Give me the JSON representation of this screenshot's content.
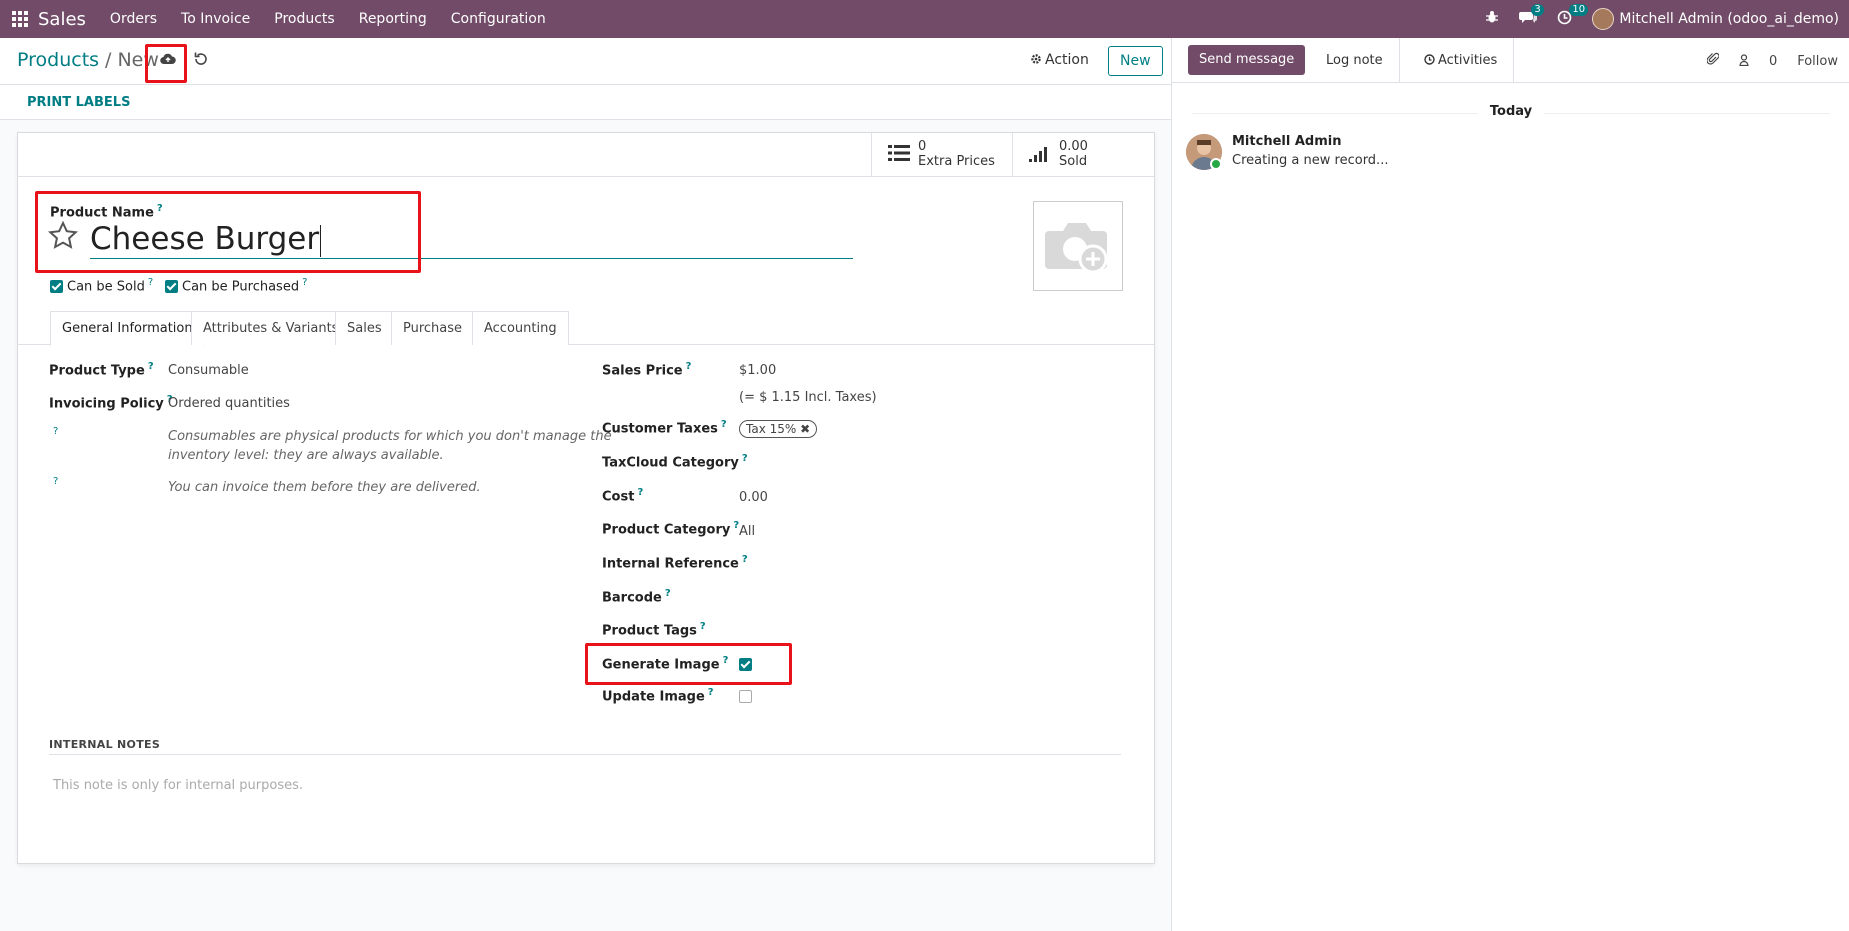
{
  "navbar": {
    "brand": "Sales",
    "menu": [
      "Orders",
      "To Invoice",
      "Products",
      "Reporting",
      "Configuration"
    ],
    "messages_count": "3",
    "activities_count": "10",
    "user": "Mitchell Admin (odoo_ai_demo)"
  },
  "breadcrumb": {
    "parent": "Products",
    "separator": "/",
    "current": "New"
  },
  "control": {
    "action_label": "Action",
    "new_label": "New",
    "print_labels": "PRINT LABELS"
  },
  "stats": {
    "extra_prices_value": "0",
    "extra_prices_label": "Extra Prices",
    "sold_value": "0.00",
    "sold_label": "Sold"
  },
  "product": {
    "name_label": "Product Name",
    "name_value": "Cheese Burger",
    "can_be_sold": "Can be Sold",
    "can_be_purchased": "Can be Purchased"
  },
  "tabs": [
    "General Information",
    "Attributes & Variants",
    "Sales",
    "Purchase",
    "Accounting"
  ],
  "general": {
    "product_type_label": "Product Type",
    "product_type_value": "Consumable",
    "invoicing_policy_label": "Invoicing Policy",
    "invoicing_policy_value": "Ordered quantities",
    "help_type_line1": "Consumables are physical products for which you don't manage the",
    "help_type_line2": "inventory level: they are always available.",
    "help_invoice": "You can invoice them before they are delivered.",
    "sales_price_label": "Sales Price",
    "sales_price_value": "$1.00",
    "sales_price_incl": "(= $ 1.15 Incl. Taxes)",
    "customer_taxes_label": "Customer Taxes",
    "customer_taxes_tag": "Tax 15%",
    "taxcloud_label": "TaxCloud Category",
    "cost_label": "Cost",
    "cost_value": "0.00",
    "category_label": "Product Category",
    "category_value": "All",
    "internal_ref_label": "Internal Reference",
    "barcode_label": "Barcode",
    "tags_label": "Product Tags",
    "generate_image_label": "Generate Image",
    "update_image_label": "Update Image",
    "help_mark": "?"
  },
  "notes": {
    "title": "INTERNAL NOTES",
    "placeholder": "This note is only for internal purposes."
  },
  "chatter": {
    "send_message": "Send message",
    "log_note": "Log note",
    "activities": "Activities",
    "followers_count": "0",
    "follow": "Follow",
    "today": "Today",
    "author": "Mitchell Admin",
    "body": "Creating a new record..."
  },
  "state": {
    "can_be_sold": true,
    "can_be_purchased": true,
    "generate_image": true,
    "update_image": false
  },
  "colors": {
    "brand": "#714b67",
    "accent": "#017e84",
    "highlight": "#e8131a"
  }
}
